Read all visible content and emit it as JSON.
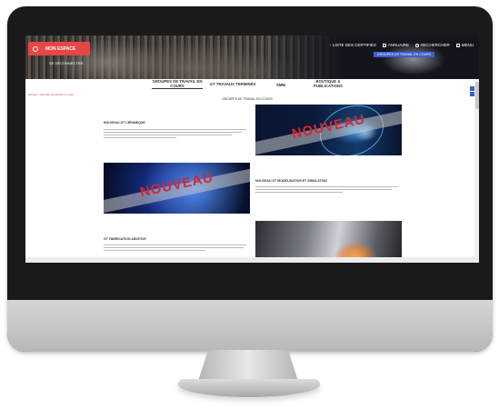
{
  "header": {
    "account_button": "MON ESPACE",
    "logout_link": "SE DÉCONNECTER",
    "nav": [
      {
        "label": "LISTE DES CERTIFIÉS",
        "icon": "arrow-icon"
      },
      {
        "label": "ANNUAIRE",
        "icon": "book-icon"
      },
      {
        "label": "RECHERCHER",
        "icon": "search-icon"
      },
      {
        "label": "MENU",
        "icon": "menu-icon"
      }
    ],
    "cta_button": "GROUPES DE TRAVAIL EN COURS"
  },
  "tabs": [
    {
      "label": "GROUPES DE TRAVAIL EN COURS",
      "active": true
    },
    {
      "label": "GT TRAVAUX TERMINÉS",
      "active": false
    },
    {
      "label": "SMM",
      "active": false
    },
    {
      "label": "BOUTIQUE & PUBLICATIONS",
      "active": false
    }
  ],
  "breadcrumb": "Accueil > Groupes de travail en cours",
  "section_title": "GROUPES DE TRAVAIL EN COURS",
  "cards": [
    {
      "heading": "NOUVEAU GT CÉRAMIQUE",
      "badge": "NOUVEAU"
    },
    {
      "heading": "NOUVEAU GT MODÉLISATION ET SIMULATION",
      "badge": "NOUVEAU"
    },
    {
      "heading": "GT FABRICATION ADDITIVE",
      "badge": ""
    }
  ],
  "colors": {
    "accent": "#e64646",
    "cta": "#3a5fd0",
    "badge_text": "#d7262e"
  }
}
